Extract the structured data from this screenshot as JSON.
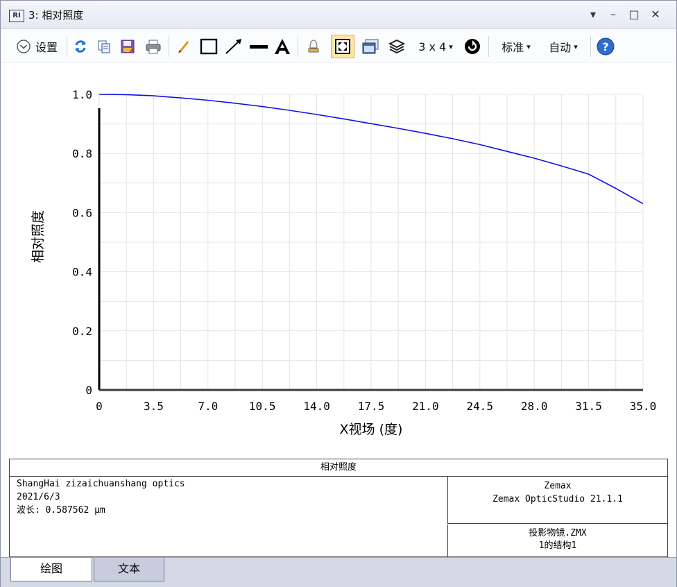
{
  "window": {
    "title": "3: 相对照度",
    "app_icon": "RI",
    "controls": {
      "menu": "▾",
      "minimize": "–",
      "maximize": "□",
      "close": "✕"
    }
  },
  "toolbar": {
    "settings_label": "设置",
    "layout_label": "3 x 4",
    "standard_label": "标准",
    "auto_label": "自动",
    "dropdown_glyph": "▾",
    "icons": [
      "chevron-down-circle-icon",
      "refresh-icon",
      "copy-icon",
      "save-icon",
      "print-icon",
      "pencil-icon",
      "rectangle-icon",
      "arrow-icon",
      "line-icon",
      "text-icon",
      "lamp-icon",
      "fit-window-icon",
      "window-icon",
      "layers-icon",
      "rotate-icon",
      "help-icon"
    ]
  },
  "chart_data": {
    "type": "line",
    "title": "",
    "xlabel": "X视场 (度)",
    "ylabel": "相对照度",
    "xlim": [
      0,
      35
    ],
    "ylim": [
      0,
      1
    ],
    "x_ticks": [
      "0",
      "3.5",
      "7.0",
      "10.5",
      "14.0",
      "17.5",
      "21.0",
      "24.5",
      "28.0",
      "31.5",
      "35.0"
    ],
    "y_ticks": [
      "0",
      "0.2",
      "0.4",
      "0.6",
      "0.8",
      "1.0"
    ],
    "grid": true,
    "series": [
      {
        "color": "#1010ee",
        "x": [
          0,
          1.75,
          3.5,
          5.25,
          7.0,
          8.75,
          10.5,
          12.25,
          14.0,
          15.75,
          17.5,
          19.25,
          21.0,
          22.75,
          24.5,
          26.25,
          28.0,
          29.75,
          31.5,
          33.25,
          35.0
        ],
        "y": [
          1.0,
          0.999,
          0.995,
          0.988,
          0.98,
          0.97,
          0.959,
          0.946,
          0.932,
          0.917,
          0.901,
          0.885,
          0.868,
          0.85,
          0.83,
          0.807,
          0.784,
          0.758,
          0.73,
          0.682,
          0.63
        ]
      }
    ]
  },
  "info": {
    "title": "相对照度",
    "left_lines": [
      "ShangHai zizaichuanshang optics",
      "2021/6/3",
      "波长: 0.587562 μm"
    ],
    "right_top_lines": [
      "Zemax",
      "Zemax OpticStudio 21.1.1"
    ],
    "right_bottom_lines": [
      "投影物镜.ZMX",
      "1的结构1"
    ]
  },
  "tabs": [
    {
      "label": "绘图",
      "active": true
    },
    {
      "label": "文本",
      "active": false
    }
  ]
}
